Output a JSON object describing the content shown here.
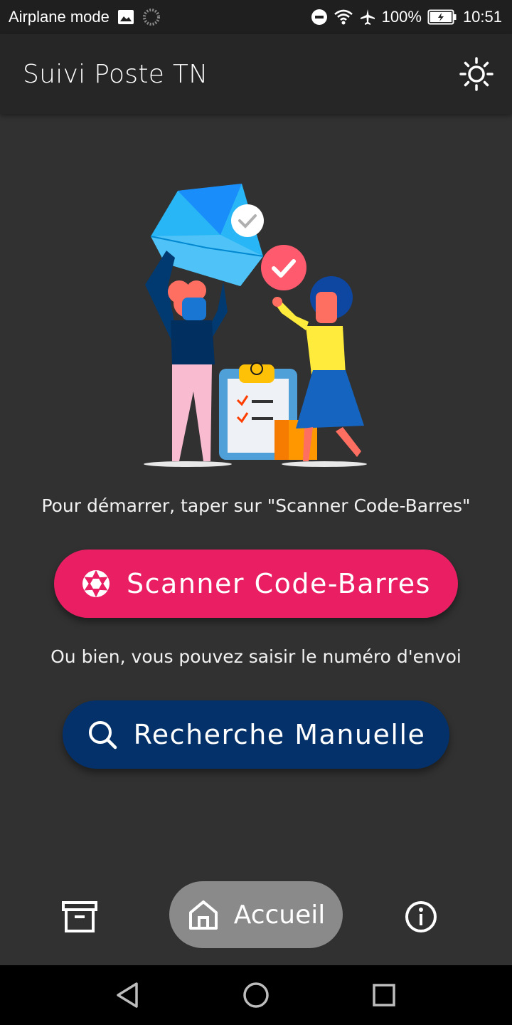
{
  "status_bar": {
    "left_text": "Airplane mode",
    "battery": "100%",
    "time": "10:51",
    "icons": [
      "image-icon",
      "sync-icon",
      "do-not-disturb-icon",
      "wifi-icon",
      "airplane-icon",
      "battery-charging-icon"
    ]
  },
  "app_bar": {
    "title": "Suivi Poste TN",
    "theme_icon": "brightness-icon"
  },
  "main": {
    "hint_scan": "Pour démarrer, taper sur \"Scanner Code-Barres\"",
    "scan_button_label": "Scanner Code-Barres",
    "hint_manual": "Ou bien, vous pouvez saisir le numéro d'envoi",
    "manual_button_label": "Recherche Manuelle"
  },
  "bottom_nav": {
    "items": [
      {
        "icon": "archive-icon"
      },
      {
        "label": "Accueil",
        "icon": "home-icon",
        "selected": true
      },
      {
        "icon": "info-icon"
      }
    ]
  },
  "colors": {
    "background": "#313131",
    "app_bar": "#262626",
    "scan_button": "#e91e63",
    "manual_button": "#04316a",
    "nav_selected": "#8a8a8a"
  }
}
